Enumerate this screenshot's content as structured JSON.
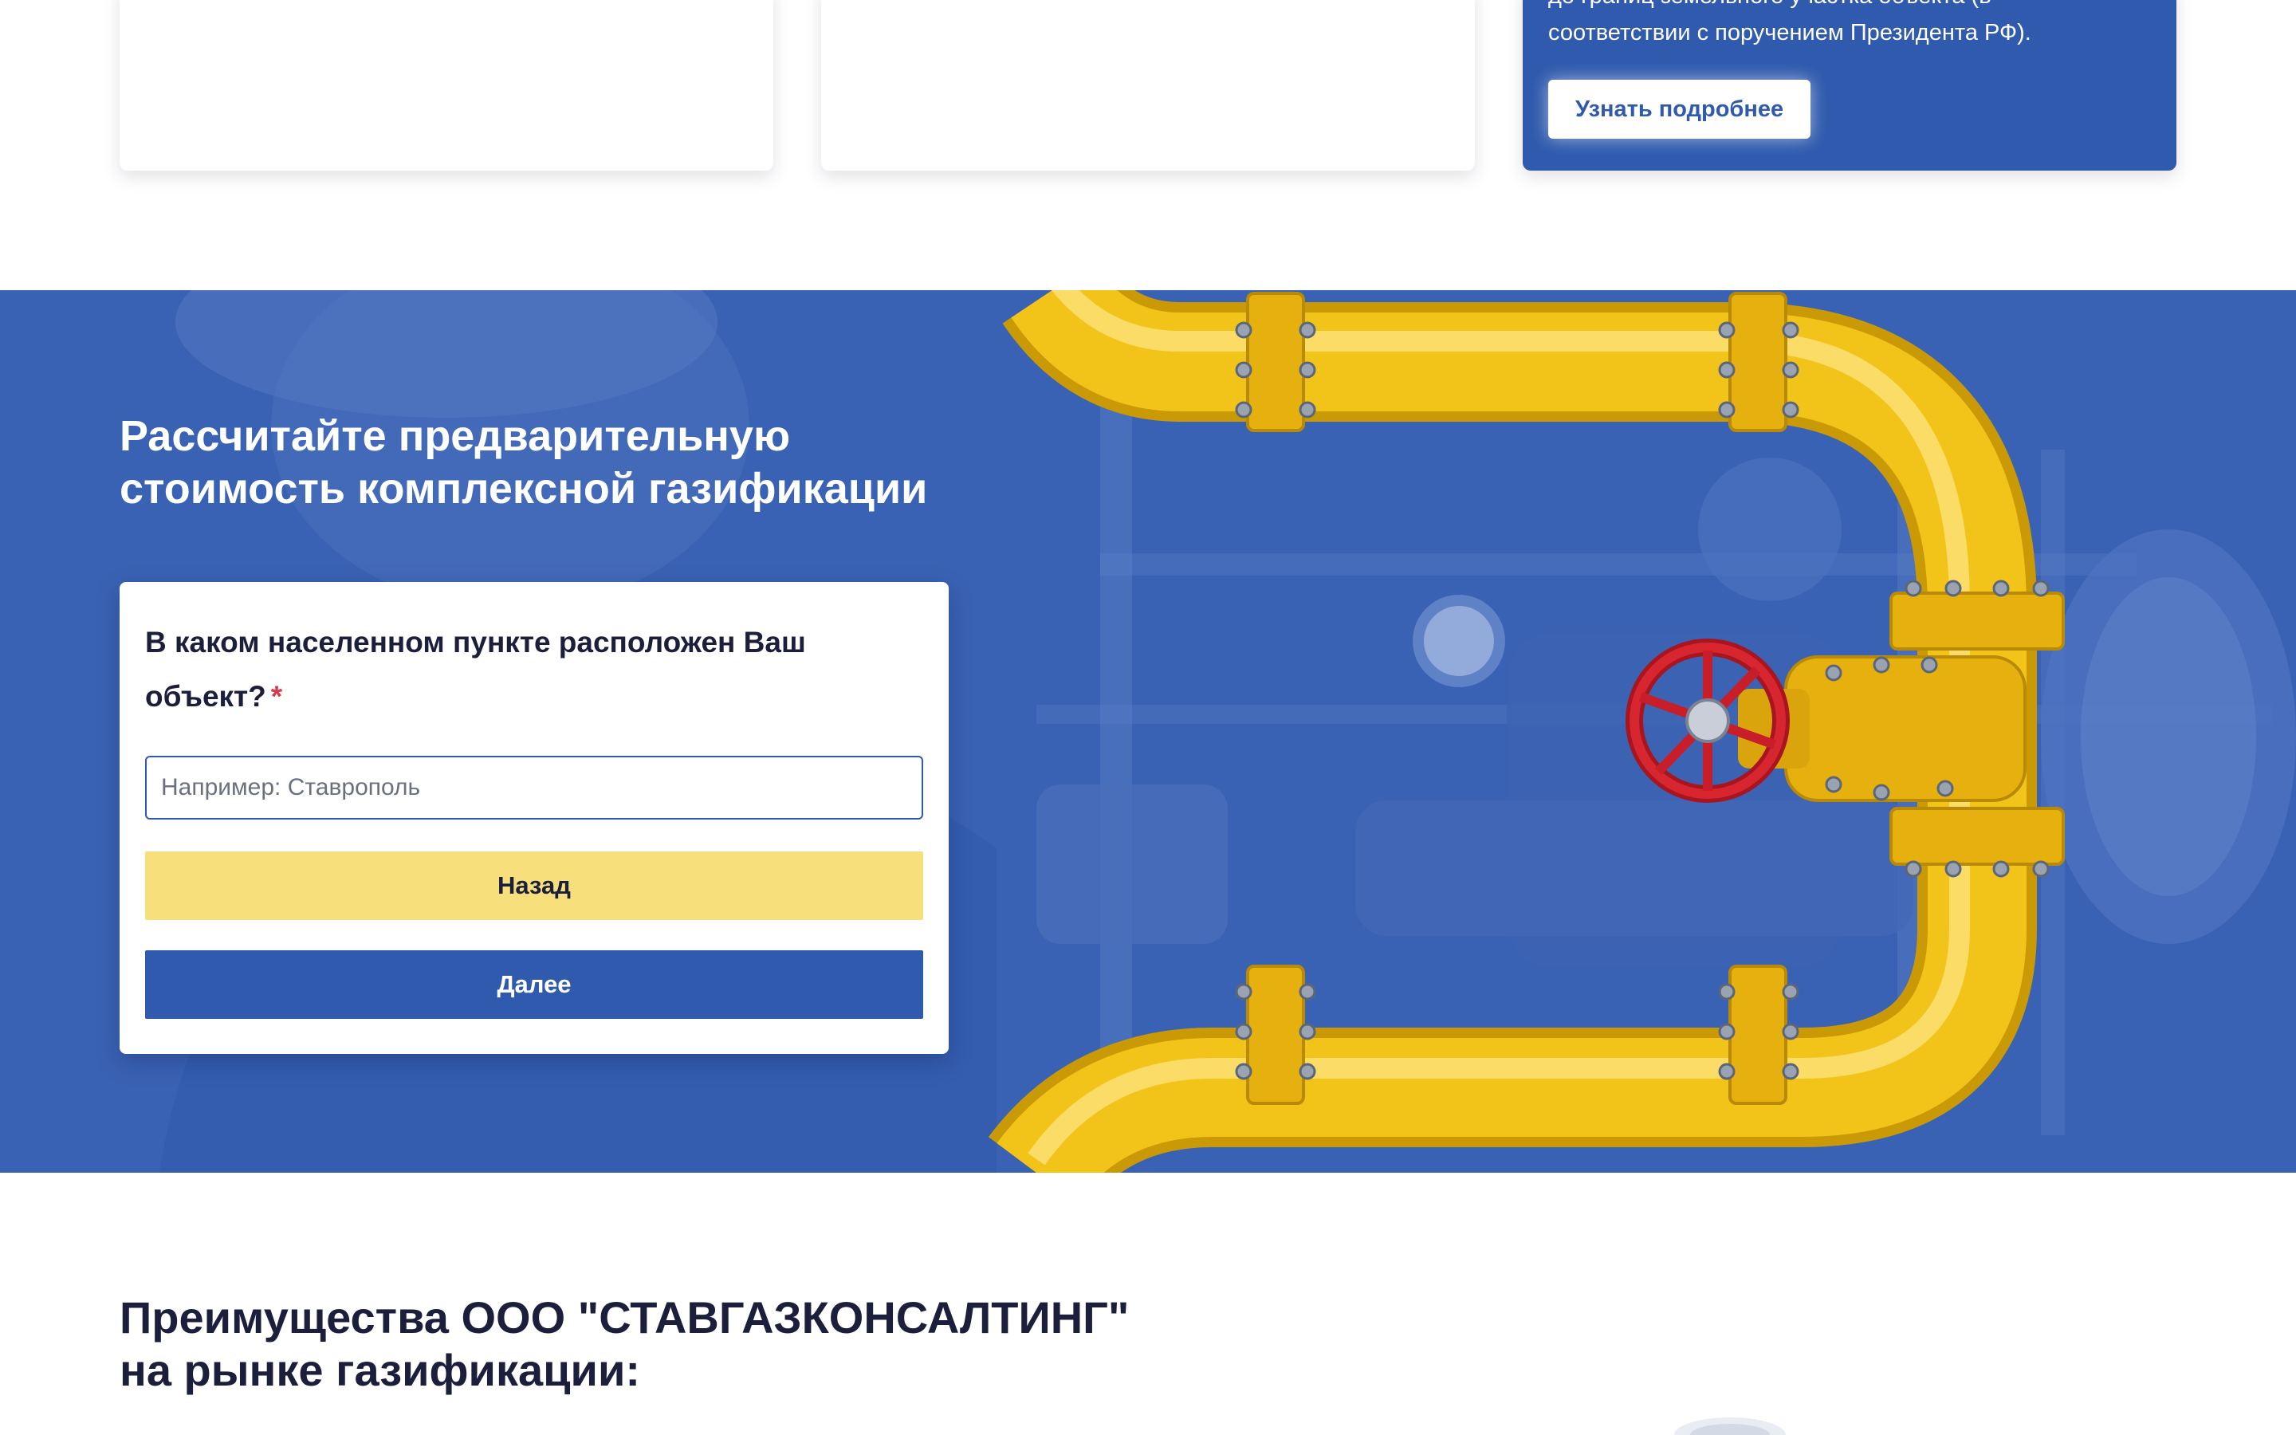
{
  "cards": {
    "card3": {
      "text_line1": "до границ земельного участка объекта (в",
      "text_line2": "соответствии с поручением Президента РФ).",
      "button_label": "Узнать подробнее"
    }
  },
  "calculator": {
    "title_line1": "Рассчитайте предварительную",
    "title_line2": "стоимость комплексной газификации",
    "question_line1": "В каком населенном пункте расположен Ваш",
    "question_line2": "объект?",
    "required_mark": "*",
    "city_input": {
      "value": "",
      "placeholder": "Например: Ставрополь"
    },
    "back_label": "Назад",
    "next_label": "Далее"
  },
  "advantages": {
    "title_line1": "Преимущества ООО \"СТАВГАЗКОНСАЛТИНГ\"",
    "title_line2": "на рынке газификации:"
  },
  "colors": {
    "brand_blue": "#2f5aad",
    "hero_overlay": "#3a62b4",
    "back_button": "#f7e07c",
    "pipe_yellow": "#f2c41a",
    "valve_red": "#c81e2a",
    "required_red": "#d63a4c"
  }
}
